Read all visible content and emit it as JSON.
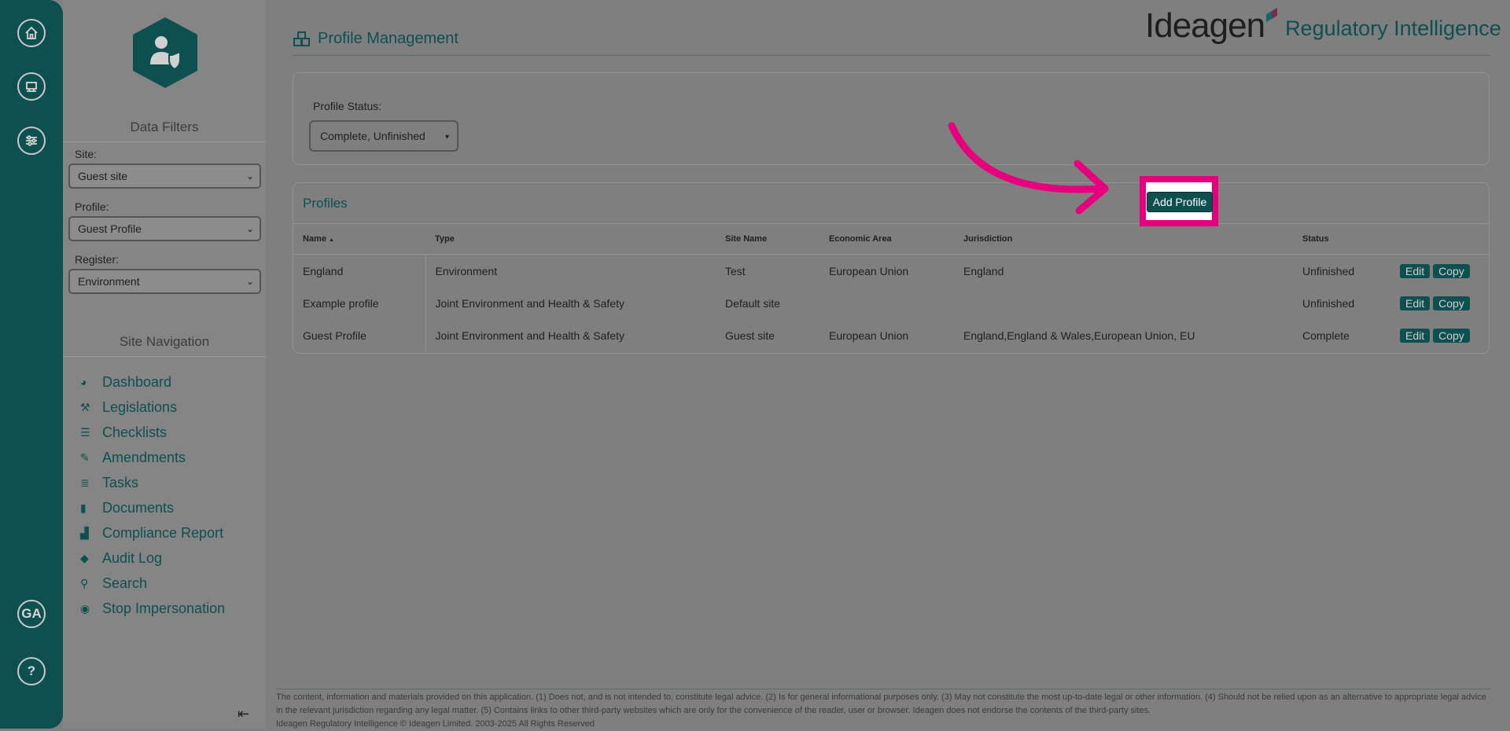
{
  "colors": {
    "brand_teal": "#0e4f4f",
    "accent_pink": "#e6007e"
  },
  "rail": {
    "items": [
      {
        "icon": "home-icon"
      },
      {
        "icon": "building-icon"
      },
      {
        "icon": "sliders-icon"
      }
    ],
    "user_initials": "GA",
    "help_label": "?"
  },
  "sidebar": {
    "logo_icon": "user-shield-icon",
    "filters_heading": "Data Filters",
    "site_label": "Site:",
    "site_value": "Guest site",
    "profile_label": "Profile:",
    "profile_value": "Guest Profile",
    "register_label": "Register:",
    "register_value": "Environment",
    "nav_heading": "Site Navigation",
    "nav": [
      {
        "label": "Dashboard",
        "icon": "gauge-icon"
      },
      {
        "label": "Legislations",
        "icon": "gavel-icon"
      },
      {
        "label": "Checklists",
        "icon": "list-icon"
      },
      {
        "label": "Amendments",
        "icon": "edit-icon"
      },
      {
        "label": "Tasks",
        "icon": "tasks-icon"
      },
      {
        "label": "Documents",
        "icon": "file-icon"
      },
      {
        "label": "Compliance Report",
        "icon": "chart-icon"
      },
      {
        "label": "Audit Log",
        "icon": "tags-icon"
      },
      {
        "label": "Search",
        "icon": "search-icon"
      },
      {
        "label": "Stop Impersonation",
        "icon": "stop-icon"
      }
    ],
    "collapse_icon": "collapse-left-icon"
  },
  "header": {
    "title": "Profile Management",
    "brand_name": "Ideagen",
    "brand_product": "Regulatory Intelligence"
  },
  "status_filter": {
    "label": "Profile Status:",
    "value": "Complete, Unfinished"
  },
  "profiles": {
    "title": "Profiles",
    "add_label": "Add Profile",
    "columns": [
      "Name",
      "Type",
      "Site Name",
      "Economic Area",
      "Jurisdiction",
      "Status"
    ],
    "sort_indicator": "▲",
    "rows": [
      {
        "name": "England",
        "type": "Environment",
        "site": "Test",
        "area": "European Union",
        "jurisdiction": "England",
        "status": "Unfinished"
      },
      {
        "name": "Example profile",
        "type": "Joint Environment and Health & Safety",
        "site": "Default site",
        "area": "",
        "jurisdiction": "",
        "status": "Unfinished"
      },
      {
        "name": "Guest Profile",
        "type": "Joint Environment and Health & Safety",
        "site": "Guest site",
        "area": "European Union",
        "jurisdiction": "England,England & Wales,European Union, EU",
        "status": "Complete"
      }
    ],
    "edit_label": "Edit",
    "copy_label": "Copy"
  },
  "footer": {
    "disclaimer": "The content, information and materials provided on this application. (1) Does not, and is not intended to, constitute legal advice. (2) Is for general informational purposes only. (3) May not constitute the most up-to-date legal or other information. (4) Should not be relied upon as an alternative to appropriate legal advice in the relevant jurisdiction regarding any legal matter. (5) Contains links to other third-party websites which are only for the convenience of the reader, user or browser. Ideagen does not endorse the contents of the third-party sites.",
    "copyright": "Ideagen Regulatory Intelligence © Ideagen Limited. 2003-2025 All Rights Reserved"
  }
}
